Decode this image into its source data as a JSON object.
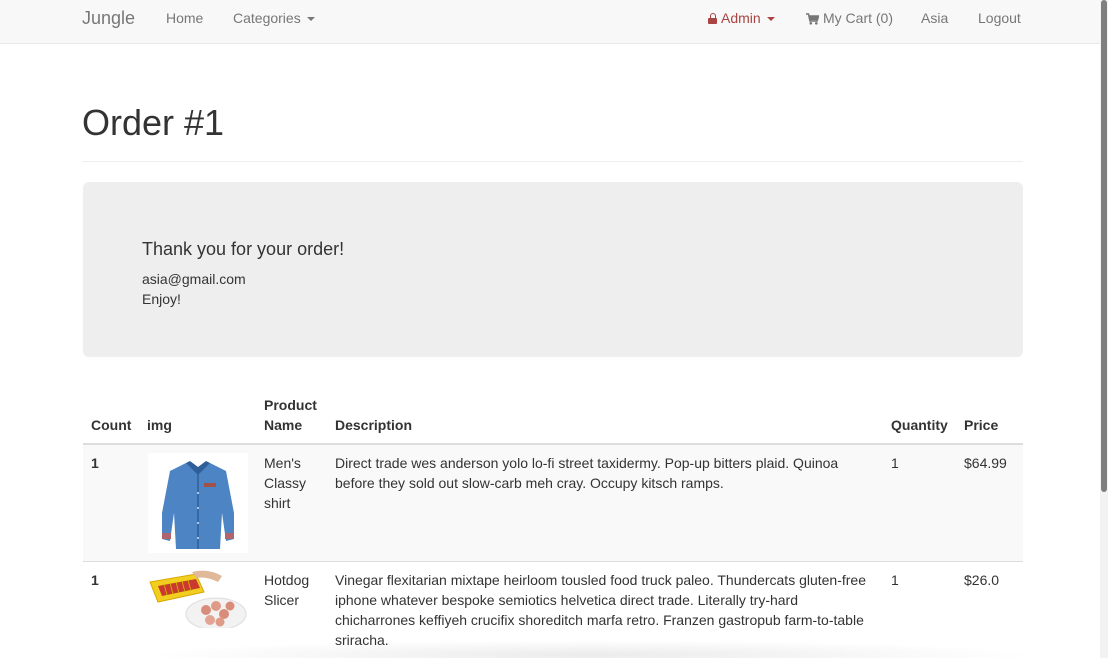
{
  "navbar": {
    "brand": "Jungle",
    "home": "Home",
    "categories": "Categories",
    "admin": "Admin",
    "cart": "My Cart (0)",
    "user": "Asia",
    "logout": "Logout",
    "admin_color": "#a94442"
  },
  "page": {
    "title": "Order #1"
  },
  "jumbotron": {
    "heading": "Thank you for your order!",
    "email": "asia@gmail.com",
    "message": "Enjoy!"
  },
  "table": {
    "headers": {
      "count": "Count",
      "img": "img",
      "product_name_1": "Product",
      "product_name_2": "Name",
      "description": "Description",
      "quantity": "Quantity",
      "price": "Price"
    },
    "rows": [
      {
        "count": "1",
        "image_icon": "shirt-image",
        "name_lines": [
          "Men's",
          "Classy",
          "shirt"
        ],
        "description_lines": [
          "Direct trade wes anderson yolo lo-fi street taxidermy. Pop-up bitters plaid. Quinoa",
          "before they sold out slow-carb meh cray. Occupy kitsch ramps."
        ],
        "quantity": "1",
        "price": "$64.99"
      },
      {
        "count": "1",
        "image_icon": "hotdog-slicer-image",
        "name_lines": [
          "Hotdog",
          "Slicer"
        ],
        "description_lines": [
          "Vinegar flexitarian mixtape heirloom tousled food truck paleo. Thundercats gluten-free",
          "iphone whatever bespoke semiotics helvetica direct trade. Literally try-hard",
          "chicharrones keffiyeh crucifix shoreditch marfa retro. Franzen gastropub farm-to-table",
          "sriracha."
        ],
        "quantity": "1",
        "price": "$26.0"
      }
    ]
  }
}
